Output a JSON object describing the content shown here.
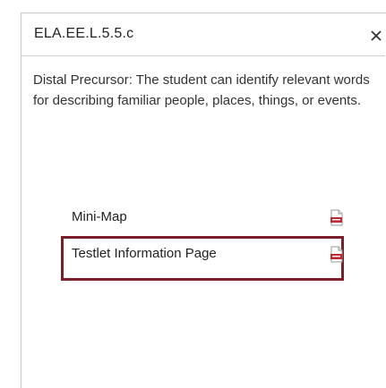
{
  "dialog": {
    "title": "ELA.EE.L.5.5.c",
    "description": "Distal Precursor: The student can identify relevant words for describing familiar people, places, things, or events.",
    "close_icon": "close-icon"
  },
  "links": [
    {
      "label": "Mini-Map",
      "icon": "pdf-icon"
    },
    {
      "label": "Testlet Information Page",
      "icon": "pdf-icon",
      "highlighted": true
    }
  ],
  "colors": {
    "highlight_border": "#7b1f2a",
    "pdf_red": "#c0282f"
  }
}
